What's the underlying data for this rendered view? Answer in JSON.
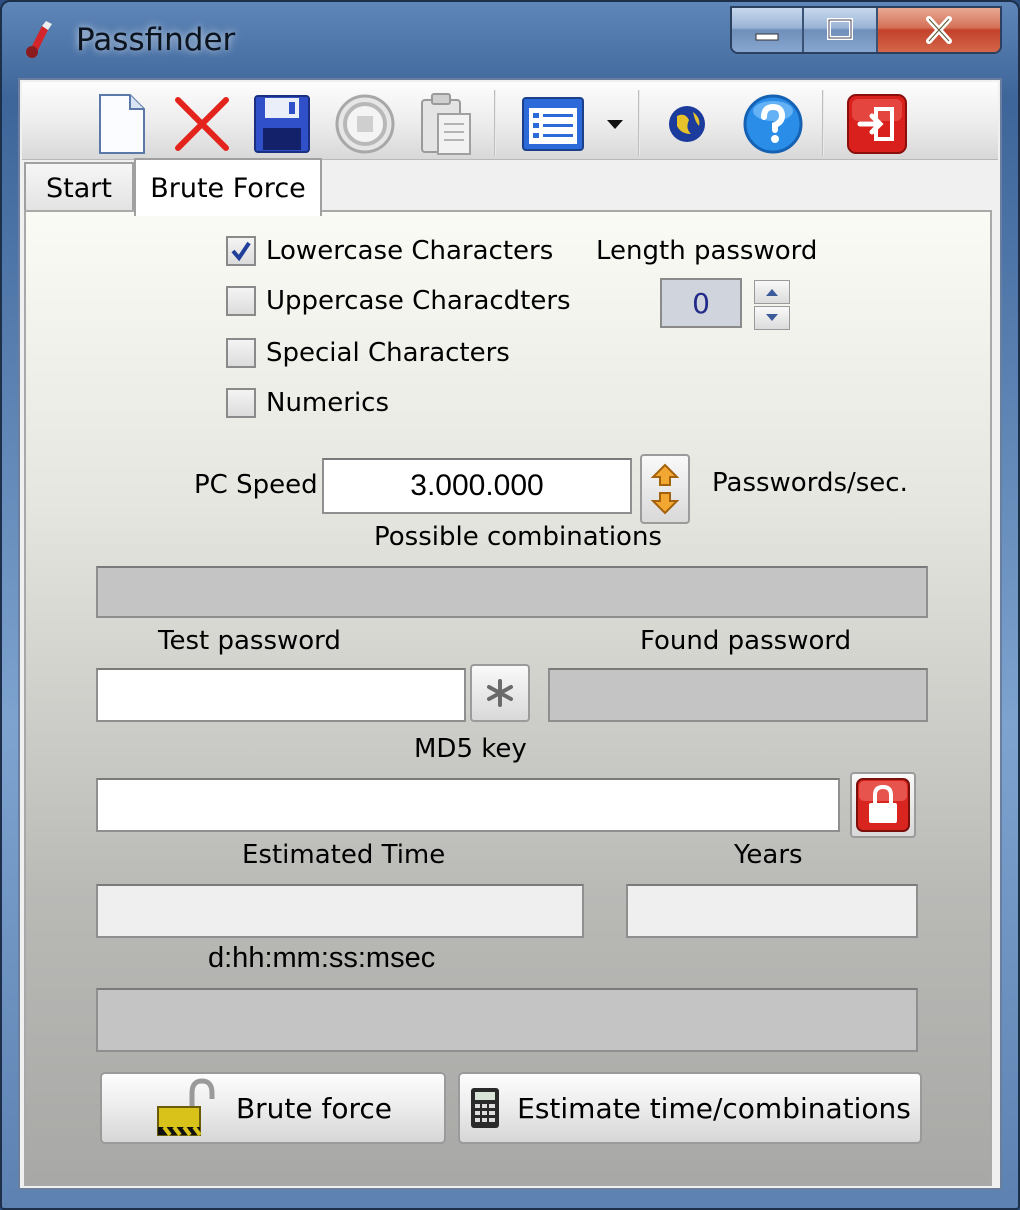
{
  "window": {
    "title": "Passfinder",
    "controls": {
      "minimize": "minimize",
      "maximize": "maximize",
      "close": "close"
    }
  },
  "toolbar": {
    "items": [
      {
        "name": "new",
        "icon": "new-document-icon"
      },
      {
        "name": "delete",
        "icon": "red-x-icon"
      },
      {
        "name": "save",
        "icon": "floppy-disk-icon"
      },
      {
        "name": "stop",
        "icon": "stop-circle-icon"
      },
      {
        "name": "paste",
        "icon": "clipboard-icon"
      },
      {
        "name": "list-view",
        "icon": "list-icon"
      },
      {
        "name": "list-dropdown",
        "icon": "dropdown-arrow-icon"
      },
      {
        "name": "web",
        "icon": "globe-icon"
      },
      {
        "name": "help",
        "icon": "help-icon"
      },
      {
        "name": "exit",
        "icon": "exit-icon"
      }
    ]
  },
  "tabs": [
    {
      "label": "Start",
      "active": false
    },
    {
      "label": "Brute Force",
      "active": true
    }
  ],
  "charset": {
    "lowercase": {
      "label": "Lowercase Characters",
      "checked": true
    },
    "uppercase": {
      "label": "Uppercase Characdters",
      "checked": false
    },
    "special": {
      "label": "Special Characters",
      "checked": false
    },
    "numerics": {
      "label": "Numerics",
      "checked": false
    }
  },
  "length": {
    "label": "Length password",
    "value": "0"
  },
  "speed": {
    "label": "PC Speed",
    "value": "3.000.000",
    "unit": "Passwords/sec."
  },
  "combinations": {
    "label": "Possible combinations",
    "value": ""
  },
  "test_password": {
    "label": "Test password",
    "value": ""
  },
  "found_password": {
    "label": "Found password",
    "value": ""
  },
  "md5": {
    "label": "MD5 key",
    "value": ""
  },
  "estimated_time": {
    "label": "Estimated Time",
    "value": ""
  },
  "years": {
    "label": "Years",
    "value": ""
  },
  "time_format": {
    "label": "d:hh:mm:ss:msec",
    "value": ""
  },
  "buttons": {
    "brute_force": "Brute force",
    "estimate": "Estimate time/combinations"
  },
  "colors": {
    "title_bar": "#3d6599",
    "close_button": "#c2412a",
    "checkbox_check": "#1f3f9a",
    "spin_value": "#222a8a"
  }
}
